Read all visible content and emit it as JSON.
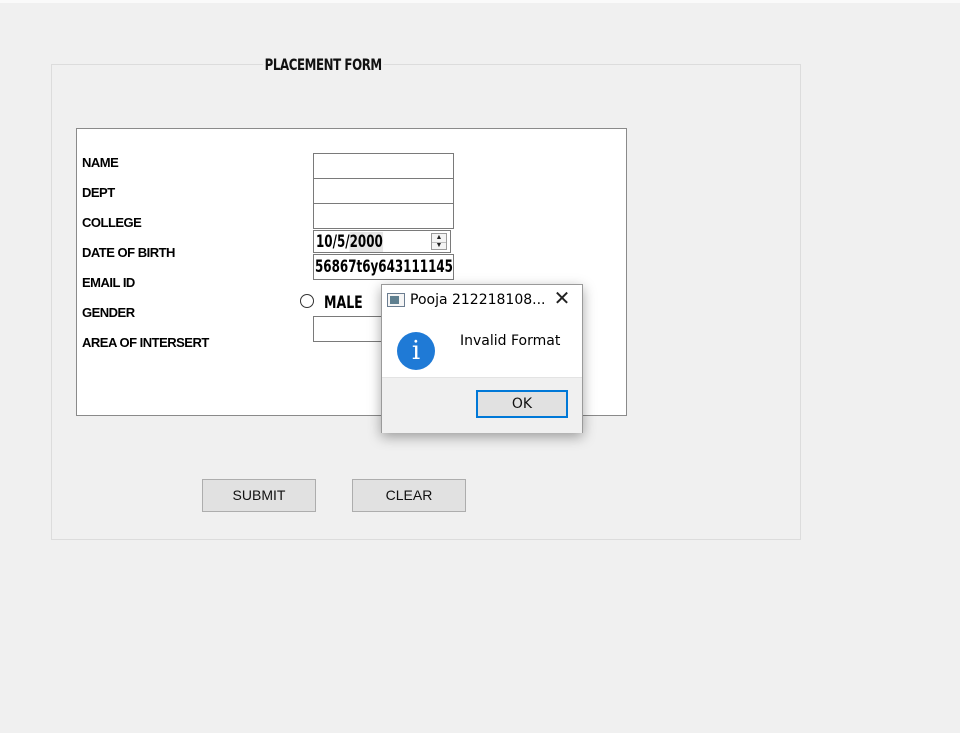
{
  "form": {
    "title": "PLACEMENT FORM",
    "labels": {
      "name": "NAME",
      "dept": "DEPT",
      "college": "COLLEGE",
      "dob": "DATE OF BIRTH",
      "email": "EMAIL ID",
      "gender": "GENDER",
      "interest": "AREA OF INTERSERT"
    },
    "fields": {
      "name": "",
      "dept": "",
      "college": "",
      "dob_prefix": "10/5/",
      "dob_year": "2000",
      "email": "56867t6y643111145",
      "interest": ""
    },
    "gender_option": "MALE",
    "buttons": {
      "submit": "SUBMIT",
      "clear": "CLEAR"
    }
  },
  "dialog": {
    "title": "Pooja 212218108...",
    "message": "Invalid Format",
    "ok": "OK",
    "icon": "info-icon",
    "accent": "#0078d7"
  }
}
